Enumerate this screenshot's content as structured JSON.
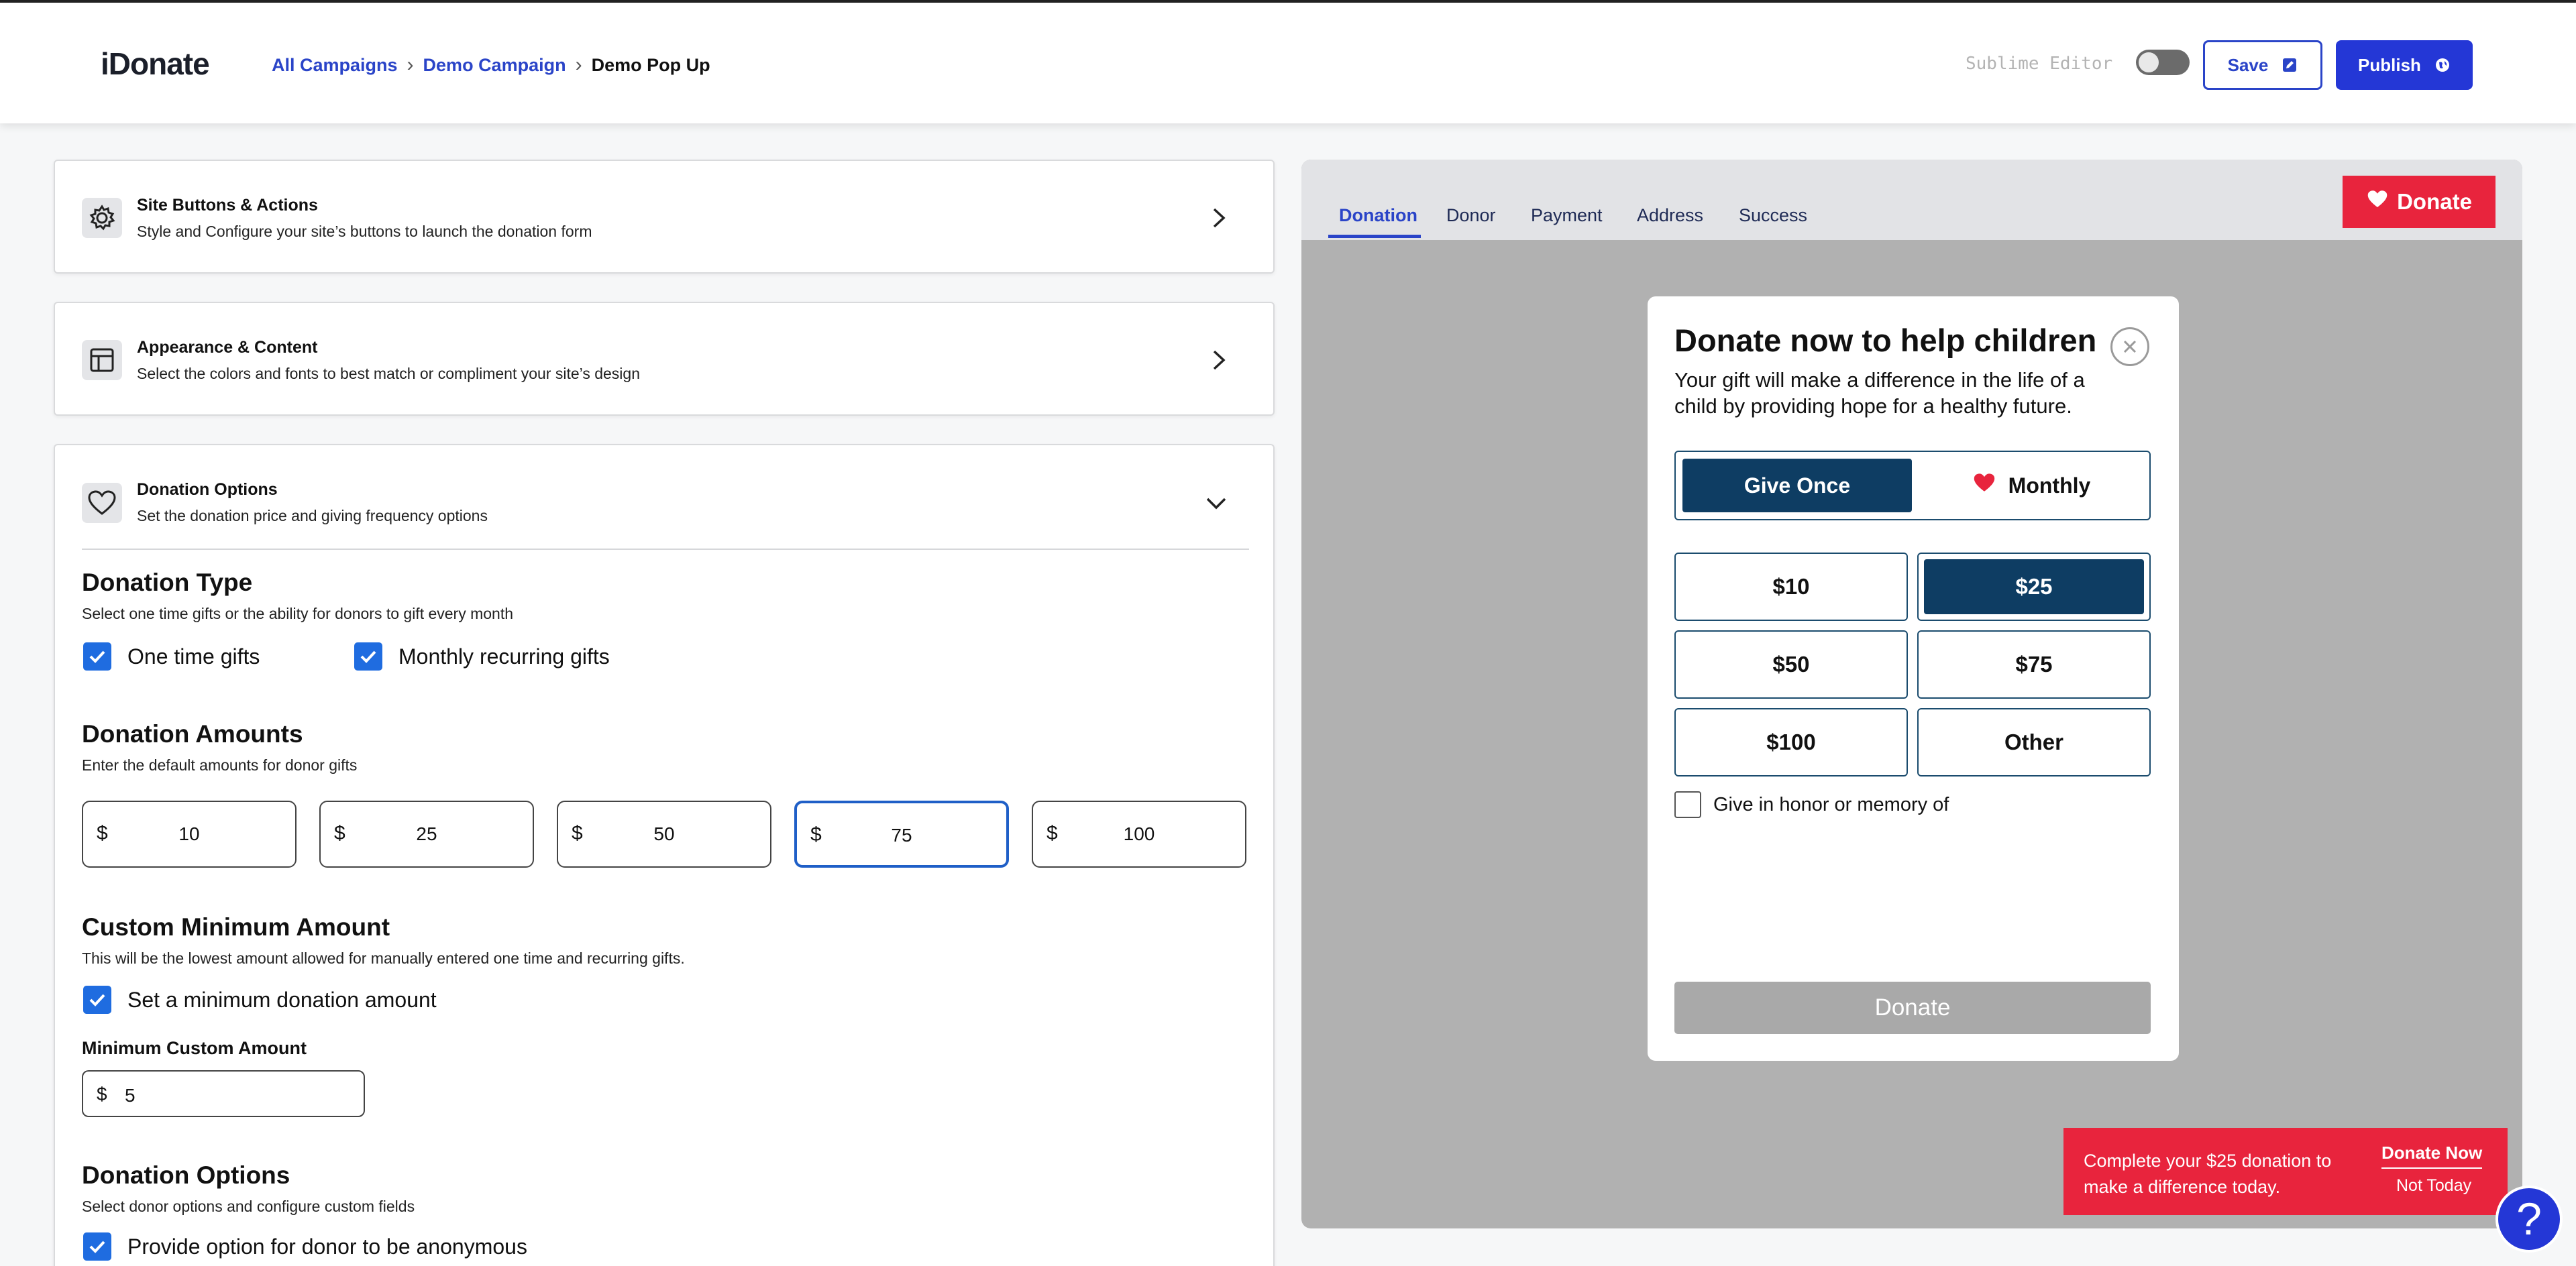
{
  "app": {
    "logo_text": "iDonate"
  },
  "breadcrumb": [
    "All Campaigns",
    "Demo Campaign",
    "Demo Pop Up"
  ],
  "header": {
    "editor_label": "Sublime Editor",
    "editor_toggle_on": false,
    "save_label": "Save",
    "publish_label": "Publish"
  },
  "sections": [
    {
      "title": "Site Buttons & Actions",
      "subtitle": "Style and Configure your site’s buttons to launch the donation form",
      "icon": "gear-icon"
    },
    {
      "title": "Appearance & Content",
      "subtitle": "Select the colors and fonts to best match or compliment your site’s design",
      "icon": "layout-icon"
    },
    {
      "title": "Donation Options",
      "subtitle": "Set the donation price and giving frequency options",
      "icon": "heart-icon"
    }
  ],
  "donation_type": {
    "title": "Donation Type",
    "subtitle": "Select one time gifts or the ability for donors to gift every month",
    "options": [
      {
        "label": "One time gifts",
        "checked": true
      },
      {
        "label": "Monthly recurring gifts",
        "checked": true
      }
    ]
  },
  "donation_amounts": {
    "title": "Donation Amounts",
    "subtitle": "Enter the default amounts for donor gifts",
    "currency": "$",
    "values": [
      "10",
      "25",
      "50",
      "75",
      "100"
    ],
    "focused_index": 3
  },
  "custom_minimum": {
    "title": "Custom Minimum Amount",
    "subtitle": "This will be the lowest amount allowed for manually entered one time and recurring gifts.",
    "checkbox_label": "Set a minimum donation amount",
    "checked": true,
    "field_label": "Minimum Custom Amount",
    "currency": "$",
    "value": "5"
  },
  "donation_options": {
    "title": "Donation Options",
    "subtitle": "Select donor options and configure custom fields",
    "anonymous_label": "Provide option for donor to be anonymous",
    "anonymous_checked": true
  },
  "preview": {
    "tabs": [
      "Donation",
      "Donor",
      "Payment",
      "Address",
      "Success"
    ],
    "active_tab": 0,
    "donate_badge_label": "Donate",
    "modal": {
      "title": "Donate now to help children",
      "subtitle": "Your gift will make a difference in the life of a child by providing hope for a healthy future.",
      "frequency": {
        "once_label": "Give Once",
        "monthly_label": "Monthly",
        "selected": "once"
      },
      "amounts": [
        "$10",
        "$25",
        "$50",
        "$75",
        "$100",
        "Other"
      ],
      "selected_amount_index": 1,
      "honor_label": "Give in honor or memory of",
      "honor_checked": false,
      "donate_label": "Donate"
    },
    "banner": {
      "text": "Complete your $25 donation to make a difference today.",
      "cta_label": "Donate Now",
      "dismiss_label": "Not Today"
    }
  },
  "help": {
    "label": "?"
  },
  "colors": {
    "primary_blue": "#2437d6",
    "navy": "#0e3d63",
    "brand_red": "#e8243d",
    "checkbox_blue": "#1f6ce0"
  }
}
